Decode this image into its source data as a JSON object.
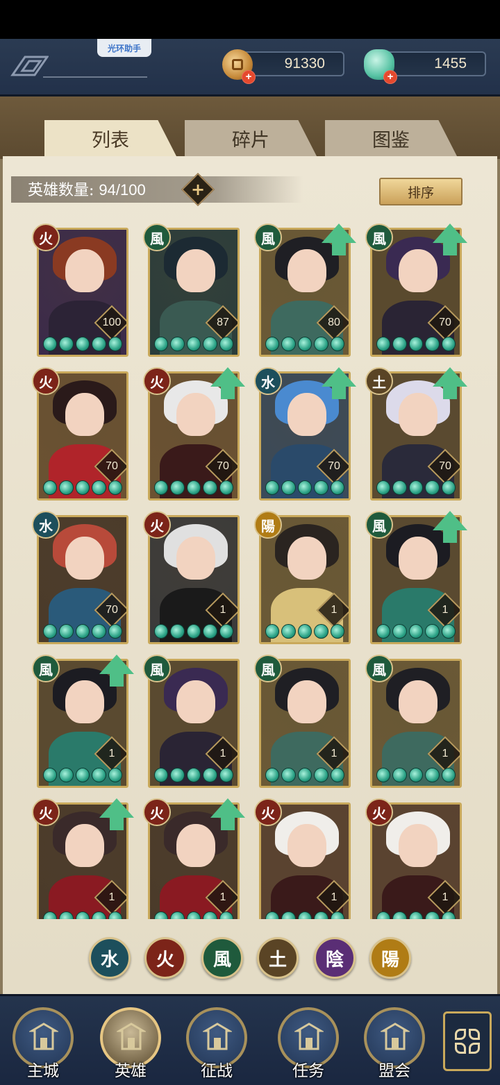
{
  "header": {
    "helper_label": "光环助手",
    "coins": "91330",
    "gems": "1455"
  },
  "tabs": [
    {
      "label": "列表",
      "active": true
    },
    {
      "label": "碎片",
      "active": false
    },
    {
      "label": "图鉴",
      "active": false
    }
  ],
  "hero_count": {
    "label": "英雄数量:",
    "value": "94/100"
  },
  "sort_label": "排序",
  "element_glyphs": {
    "fire": "火",
    "wind": "風",
    "water": "水",
    "earth": "土",
    "yin": "陰",
    "yang": "陽"
  },
  "heroes": [
    {
      "element": "fire",
      "level": "100",
      "upgrade": false
    },
    {
      "element": "wind",
      "level": "87",
      "upgrade": false
    },
    {
      "element": "wind",
      "level": "80",
      "upgrade": true
    },
    {
      "element": "wind",
      "level": "70",
      "upgrade": true
    },
    {
      "element": "fire",
      "level": "70",
      "upgrade": false
    },
    {
      "element": "fire",
      "level": "70",
      "upgrade": true
    },
    {
      "element": "water",
      "level": "70",
      "upgrade": true
    },
    {
      "element": "earth",
      "level": "70",
      "upgrade": true
    },
    {
      "element": "water",
      "level": "70",
      "upgrade": false
    },
    {
      "element": "fire",
      "level": "1",
      "upgrade": false
    },
    {
      "element": "yang",
      "level": "1",
      "upgrade": false
    },
    {
      "element": "wind",
      "level": "1",
      "upgrade": true
    },
    {
      "element": "wind",
      "level": "1",
      "upgrade": true
    },
    {
      "element": "wind",
      "level": "1",
      "upgrade": false
    },
    {
      "element": "wind",
      "level": "1",
      "upgrade": false
    },
    {
      "element": "wind",
      "level": "1",
      "upgrade": false
    },
    {
      "element": "fire",
      "level": "1",
      "upgrade": true
    },
    {
      "element": "fire",
      "level": "1",
      "upgrade": true
    },
    {
      "element": "fire",
      "level": "1",
      "upgrade": false
    },
    {
      "element": "fire",
      "level": "1",
      "upgrade": false
    }
  ],
  "filters": [
    "water",
    "fire",
    "wind",
    "earth",
    "yin",
    "yang"
  ],
  "bottom_nav": [
    {
      "label": "主城",
      "icon": "castle-icon"
    },
    {
      "label": "英雄",
      "icon": "hero-icon",
      "active": true
    },
    {
      "label": "征战",
      "icon": "battle-icon"
    },
    {
      "label": "任务",
      "icon": "scroll-icon"
    },
    {
      "label": "盟会",
      "icon": "guild-icon"
    }
  ],
  "colors": {
    "fire": "#7c2419",
    "wind": "#1f5a3c",
    "water": "#1d4f5c",
    "earth": "#5a4425",
    "yin": "#5a2e75",
    "yang": "#b07c15",
    "upgrade_arrow": "#4fbf87"
  }
}
